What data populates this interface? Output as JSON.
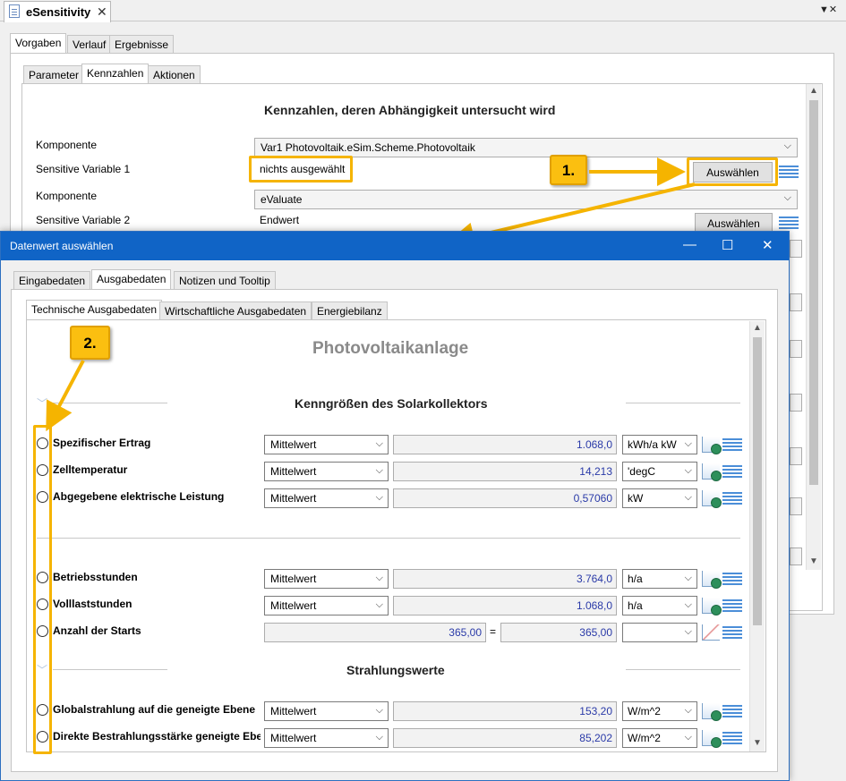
{
  "document_tab": {
    "title": "eSensitivity",
    "close": "✕",
    "menu": "▼✕"
  },
  "outer_tabs": [
    "Vorgaben",
    "Verlauf",
    "Ergebnisse"
  ],
  "inner_tabs": [
    "Parameter",
    "Kennzahlen",
    "Aktionen"
  ],
  "kennzahlen": {
    "heading": "Kennzahlen, deren Abhängigkeit untersucht wird",
    "rows": [
      {
        "label": "Komponente",
        "value": "Var1 Photovoltaik.eSim.Scheme.Photovoltaik"
      },
      {
        "label": "Sensitive Variable 1",
        "value": "nichts ausgewählt",
        "button": "Auswählen"
      },
      {
        "label": "Komponente",
        "value": "eValuate"
      },
      {
        "label": "Sensitive Variable 2",
        "value": "Endwert",
        "button": "Auswählen"
      }
    ]
  },
  "annotations": {
    "step1": "1.",
    "step2": "2."
  },
  "dialog": {
    "title": "Datenwert auswählen",
    "controls": {
      "minimize": "—",
      "maximize": "☐",
      "close": "✕"
    },
    "tabs": [
      "Eingabedaten",
      "Ausgabedaten",
      "Notizen und Tooltip"
    ],
    "subtabs": [
      "Technische Ausgabedaten",
      "Wirtschaftliche Ausgabedaten",
      "Energiebilanz"
    ],
    "heading": "Photovoltaikanlage",
    "sections": [
      {
        "title": "Kenngrößen des Solarkollektors",
        "rows": [
          {
            "label": "Spezifischer Ertrag",
            "mode": "Mittelwert",
            "value": "1.068,0",
            "unit": "kWh/a kW"
          },
          {
            "label": "Zelltemperatur",
            "mode": "Mittelwert",
            "value": "14,213",
            "unit": "'degC"
          },
          {
            "label": "Abgegebene elektrische Leistung",
            "mode": "Mittelwert",
            "value": "0,57060",
            "unit": "kW"
          }
        ]
      },
      {
        "title": "",
        "rows": [
          {
            "label": "Betriebsstunden",
            "mode": "Mittelwert",
            "value": "3.764,0",
            "unit": "h/a"
          },
          {
            "label": "Volllaststunden",
            "mode": "Mittelwert",
            "value": "1.068,0",
            "unit": "h/a"
          },
          {
            "label": "Anzahl der Starts",
            "value_a": "365,00",
            "equals": "=",
            "value_b": "365,00",
            "unit": ""
          }
        ]
      },
      {
        "title": "Strahlungswerte",
        "rows": [
          {
            "label": "Globalstrahlung auf die geneigte Ebene",
            "mode": "Mittelwert",
            "value": "153,20",
            "unit": "W/m^2"
          },
          {
            "label": "Direkte Bestrahlungsstärke geneigte Ebene",
            "mode": "Mittelwert",
            "value": "85,202",
            "unit": "W/m^2"
          }
        ]
      }
    ]
  },
  "colors": {
    "highlight": "#f5b400",
    "titlebar": "#1064c6",
    "value_text": "#2a3aa8"
  }
}
